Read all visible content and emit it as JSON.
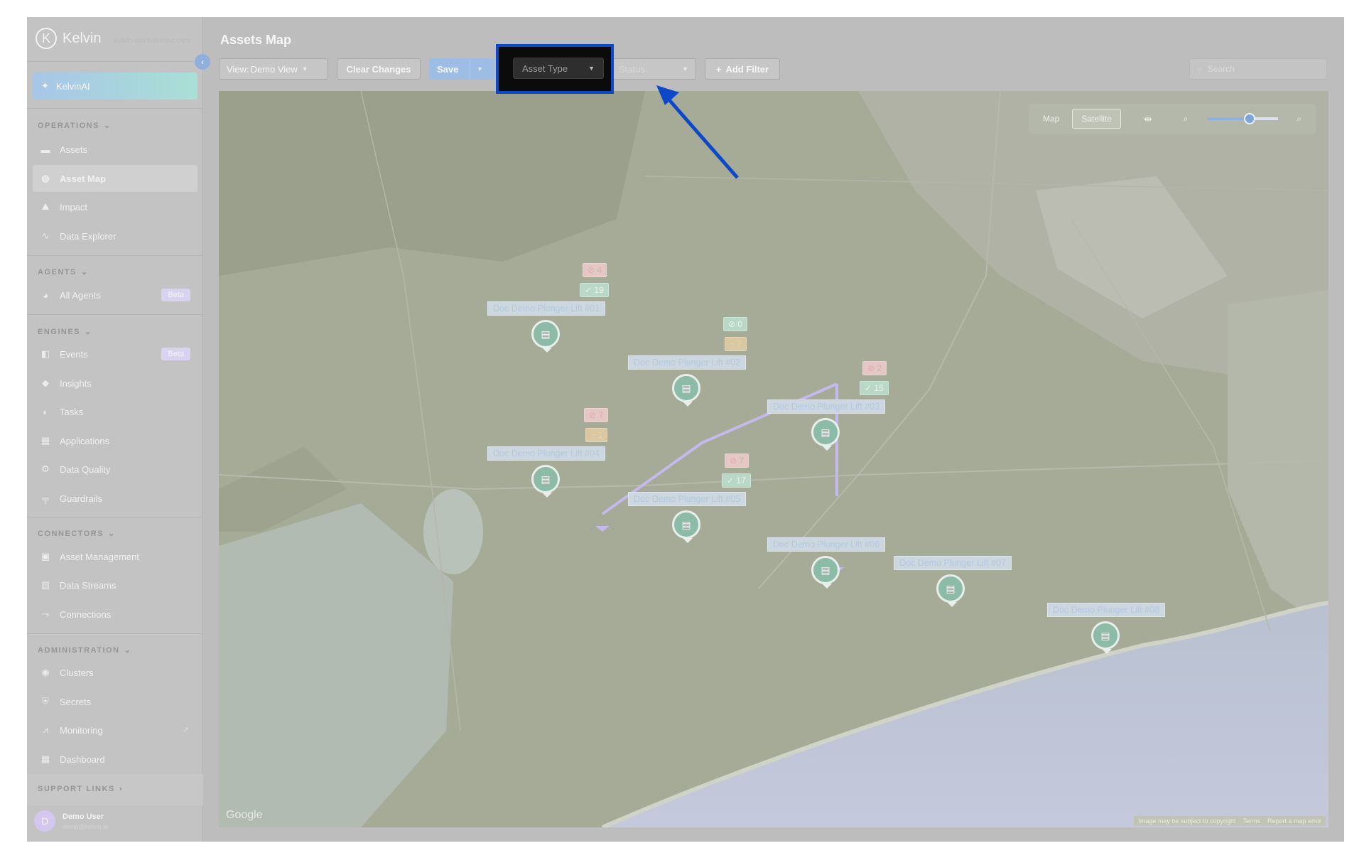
{
  "app": {
    "logo_letter": "K",
    "name": "Kelvin",
    "subtitle": "kelvin-dev.kelvininc.com"
  },
  "sidebar": {
    "kelvinai_label": "KelvinAI",
    "sections": {
      "operations": "OPERATIONS",
      "agents": "AGENTS",
      "engines": "ENGINES",
      "connectors": "CONNECTORS",
      "administration": "ADMINISTRATION",
      "support": "SUPPORT LINKS"
    },
    "items": {
      "assets": "Assets",
      "asset_map": "Asset Map",
      "impact": "Impact",
      "data_explorer": "Data Explorer",
      "all_agents": "All Agents",
      "events": "Events",
      "insights": "Insights",
      "tasks": "Tasks",
      "applications": "Applications",
      "data_quality": "Data Quality",
      "guardrails": "Guardrails",
      "asset_management": "Asset Management",
      "data_streams": "Data Streams",
      "connections": "Connections",
      "clusters": "Clusters",
      "secrets": "Secrets",
      "monitoring": "Monitoring",
      "dashboard": "Dashboard"
    },
    "beta_label": "Beta",
    "user": {
      "initial": "D",
      "name": "Demo User",
      "email": "demo@kelvin.ai"
    }
  },
  "header": {
    "title": "Assets Map"
  },
  "toolbar": {
    "view_label": "View: ",
    "view_value": "Demo View",
    "clear_changes": "Clear Changes",
    "save": "Save",
    "asset_type": "Asset Type",
    "status": "Status",
    "add_filter": "Add Filter",
    "search_placeholder": "Search"
  },
  "map": {
    "type_map": "Map",
    "type_satellite": "Satellite",
    "active_type": "Satellite",
    "zoom_level": 0.6,
    "attribution": "Google",
    "footer": [
      "Image may be subject to copyright",
      "Terms",
      "Report a map error"
    ],
    "assets": [
      {
        "name": "Doc Demo Plunger Lift #01",
        "red": "4",
        "second": "19",
        "second_color": "green"
      },
      {
        "name": "Doc Demo Plunger Lift #02",
        "red": "0",
        "second": "7",
        "second_color": "orange",
        "first_color": "green"
      },
      {
        "name": "Doc Demo Plunger Lift #03",
        "red": "2",
        "second": "15",
        "second_color": "green"
      },
      {
        "name": "Doc Demo Plunger Lift #04",
        "red": "7",
        "second": "1",
        "second_color": "orange"
      },
      {
        "name": "Doc Demo Plunger Lift #05",
        "red": "7",
        "second": "17",
        "second_color": "green"
      },
      {
        "name": "Doc Demo Plunger Lift #06"
      },
      {
        "name": "Doc Demo Plunger Lift #07"
      },
      {
        "name": "Doc Demo Plunger Lift #08"
      }
    ]
  },
  "colors": {
    "highlight_border": "#0c48c7",
    "arrow": "#0c48c7",
    "accent_blue": "#9ebde5"
  }
}
